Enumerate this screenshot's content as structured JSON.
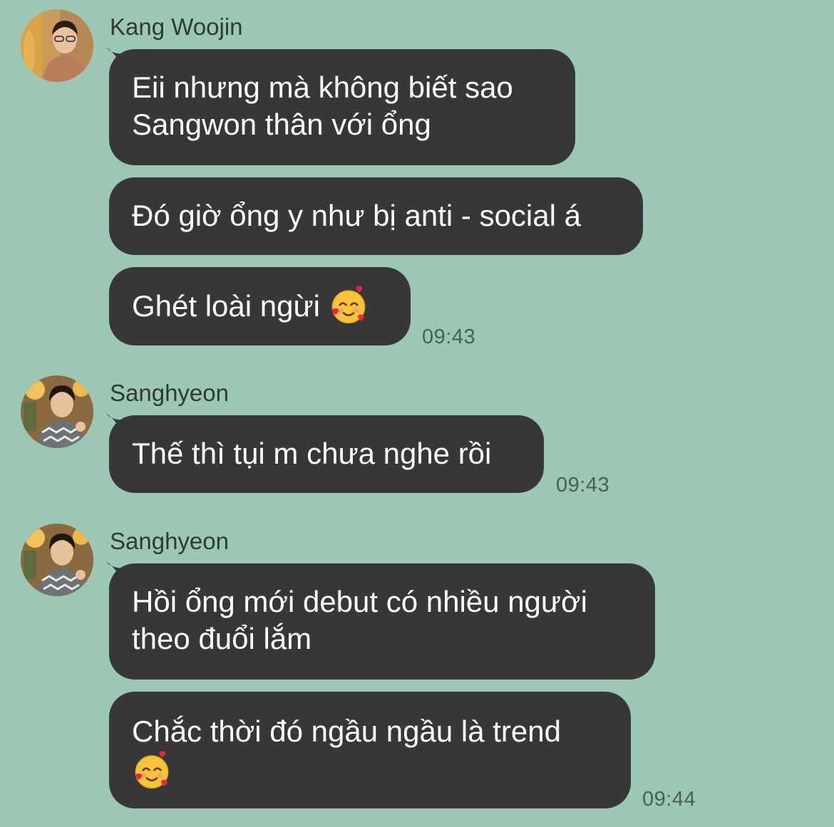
{
  "group1": {
    "sender": "Kang Woojin",
    "messages": [
      "Eii nhưng mà không biết sao\nSangwon thân với ổng",
      "Đó giờ ổng y như bị anti - social á",
      "Ghét loài ngừi"
    ],
    "time": "09:43"
  },
  "group2": {
    "sender": "Sanghyeon",
    "messages": [
      "Thế thì tụi m chưa nghe rồi"
    ],
    "time": "09:43"
  },
  "group3": {
    "sender": "Sanghyeon",
    "messages": [
      "Hồi ổng mới debut có nhiều người\ntheo đuổi lắm",
      "Chắc thời đó ngầu ngầu là trend"
    ],
    "time": "09:44"
  },
  "emoji": "smiling-face-with-hearts-icon",
  "colors": {
    "background": "#9dc7b5",
    "bubble": "#373739",
    "bubble_text": "#ffffff",
    "name_text": "#2f3a35",
    "time_text": "#4b5d55"
  }
}
